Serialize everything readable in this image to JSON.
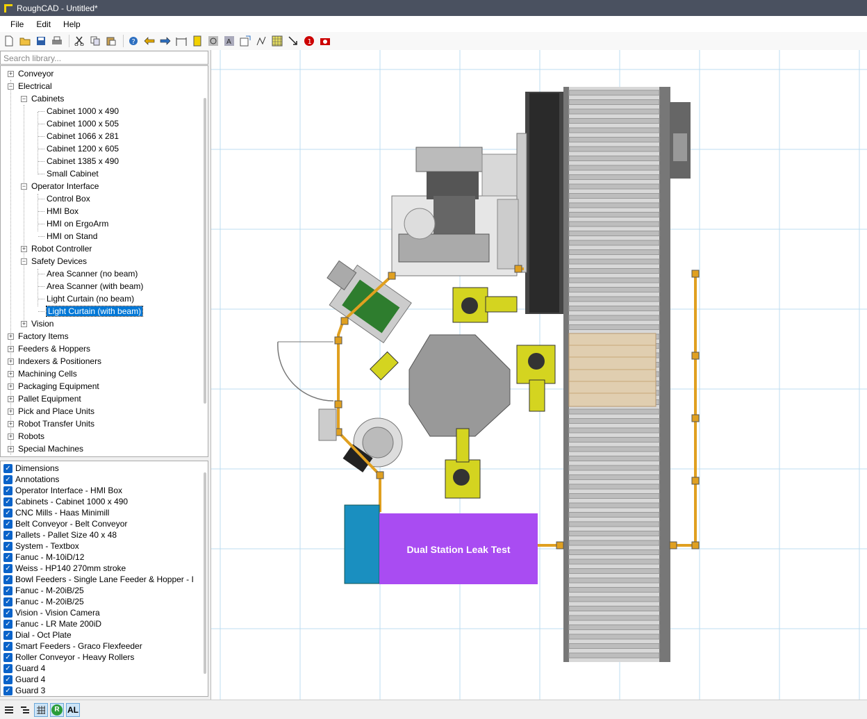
{
  "window": {
    "title": "RoughCAD - Untitled*"
  },
  "menu": {
    "file": "File",
    "edit": "Edit",
    "help": "Help"
  },
  "toolbar": {
    "icons": [
      "new-file-icon",
      "open-folder-icon",
      "save-icon",
      "print-icon",
      "cut-icon",
      "copy-icon",
      "paste-icon",
      "help-icon",
      "undo-arrow-icon",
      "redo-arrow-icon",
      "dimension-icon",
      "ruler-icon",
      "annotation-icon",
      "text-icon",
      "export-icon",
      "polyline-icon",
      "grid-icon",
      "arrow-line-icon",
      "alert-icon",
      "camera-icon"
    ]
  },
  "search": {
    "placeholder": "Search library..."
  },
  "tree": {
    "conveyor": "Conveyor",
    "electrical": "Electrical",
    "cabinets": "Cabinets",
    "cab1": "Cabinet 1000 x 490",
    "cab2": "Cabinet 1000 x 505",
    "cab3": "Cabinet 1066 x 281",
    "cab4": "Cabinet 1200 x 605",
    "cab5": "Cabinet 1385 x 490",
    "cab6": "Small Cabinet",
    "operator_interface": "Operator Interface",
    "oi1": "Control Box",
    "oi2": "HMI Box",
    "oi3": "HMI on ErgoArm",
    "oi4": "HMI on Stand",
    "robot_controller": "Robot Controller",
    "safety_devices": "Safety Devices",
    "sd1": "Area Scanner (no beam)",
    "sd2": "Area Scanner (with beam)",
    "sd3": "Light Curtain (no beam)",
    "sd4": "Light Curtain (with beam)",
    "vision": "Vision",
    "factory_items": "Factory Items",
    "feeders": "Feeders & Hoppers",
    "indexers": "Indexers & Positioners",
    "machining": "Machining Cells",
    "packaging": "Packaging Equipment",
    "pallet": "Pallet Equipment",
    "pick_place": "Pick and Place Units",
    "robot_transfer": "Robot Transfer Units",
    "robots": "Robots",
    "special": "Special Machines"
  },
  "layers": [
    "Dimensions",
    "Annotations",
    "Operator Interface - HMI Box",
    "Cabinets - Cabinet 1000 x 490",
    "CNC Mills - Haas Minimill",
    "Belt Conveyor - Belt Conveyor",
    "Pallets - Pallet Size 40 x 48",
    "System - Textbox",
    "Fanuc - M-10iD/12",
    "Weiss - HP140 270mm stroke",
    "Bowl Feeders - Single Lane Feeder & Hopper - I",
    "Fanuc - M-20iB/25",
    "Fanuc - M-20iB/25",
    "Vision - Vision Camera",
    "Fanuc - LR Mate 200iD",
    "Dial - Oct Plate",
    "Smart Feeders - Graco Flexfeeder",
    "Roller Conveyor - Heavy Rollers",
    "Guard 4",
    "Guard 4",
    "Guard 3"
  ],
  "canvas": {
    "textbox_label": "Dual Station Leak Test"
  },
  "statusbar": {
    "al_label": "AL",
    "r_label": "R"
  },
  "colors": {
    "accent": "#0078d7",
    "guard": "#e0a020",
    "robot": "#d4d420",
    "leak_test": "#a94cf2",
    "cabinet": "#1a8fc0"
  }
}
